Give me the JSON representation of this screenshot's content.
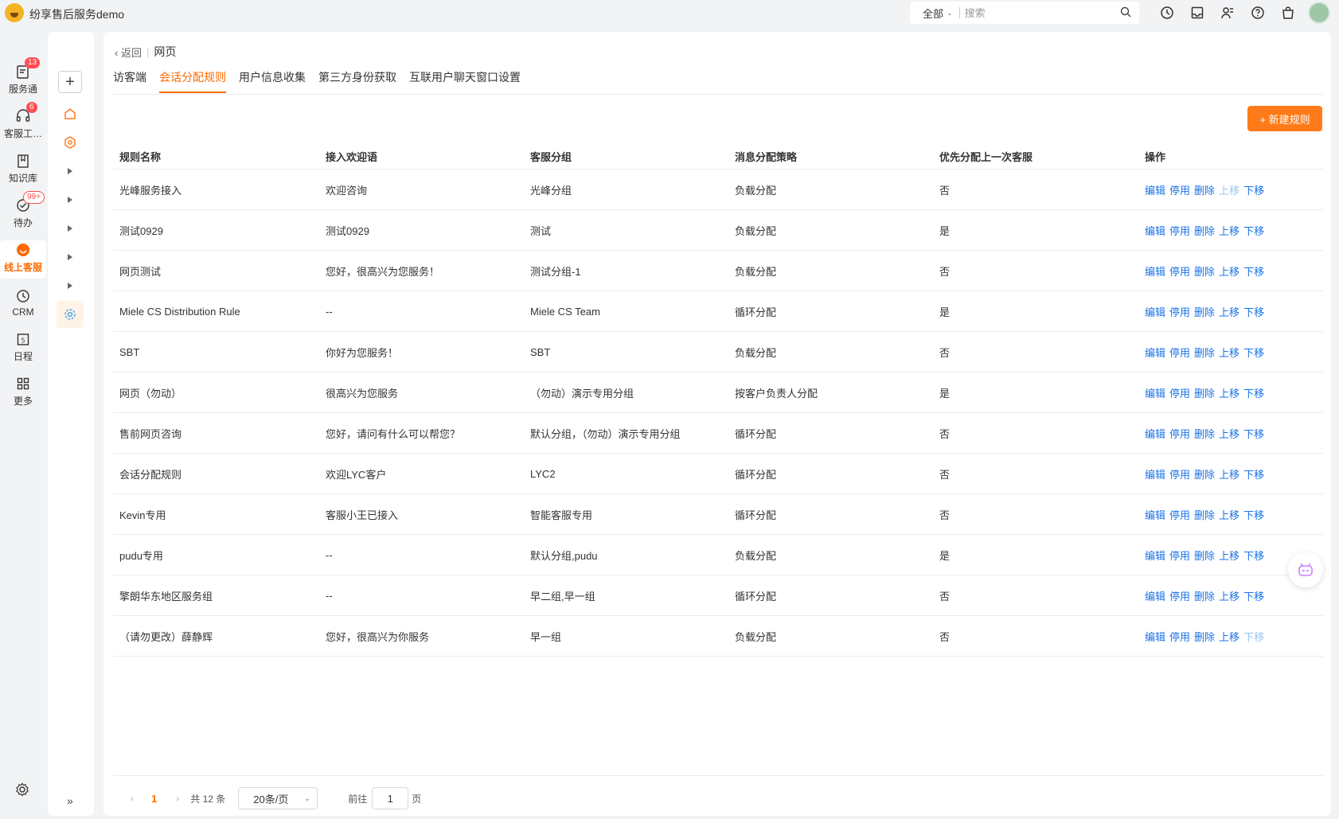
{
  "app": {
    "title": "纷享售后服务demo"
  },
  "search": {
    "scope": "全部",
    "placeholder": "搜索"
  },
  "rail": {
    "items": [
      {
        "label": "服务通",
        "badge": "13"
      },
      {
        "label": "客服工…",
        "badge": "6"
      },
      {
        "label": "知识库",
        "badge": ""
      },
      {
        "label": "待办",
        "badge": "99+"
      },
      {
        "label": "线上客服",
        "badge": ""
      },
      {
        "label": "CRM",
        "badge": ""
      },
      {
        "label": "日程",
        "badge": ""
      },
      {
        "label": "更多",
        "badge": ""
      }
    ]
  },
  "breadcrumb": {
    "back": "返回",
    "current": "网页"
  },
  "tabs": [
    "访客端",
    "会话分配规则",
    "用户信息收集",
    "第三方身份获取",
    "互联用户聊天窗口设置"
  ],
  "new_button": "+ 新建规则",
  "table": {
    "headers": [
      "规则名称",
      "接入欢迎语",
      "客服分组",
      "消息分配策略",
      "优先分配上一次客服",
      "操作"
    ],
    "ops": [
      "编辑",
      "停用",
      "删除",
      "上移",
      "下移"
    ],
    "rows": [
      [
        "光峰服务接入",
        "欢迎咨询",
        "光峰分组",
        "负载分配",
        "否"
      ],
      [
        "测试0929",
        "测试0929",
        "测试",
        "负载分配",
        "是"
      ],
      [
        "网页测试",
        "您好，很高兴为您服务！",
        "测试分组-1",
        "负载分配",
        "否"
      ],
      [
        "Miele CS Distribution Rule",
        "--",
        "Miele CS Team",
        "循环分配",
        "是"
      ],
      [
        "SBT",
        "你好为您服务！",
        "SBT",
        "负载分配",
        "否"
      ],
      [
        "网页（勿动）",
        "很高兴为您服务",
        "（勿动）演示专用分组",
        "按客户负责人分配",
        "是"
      ],
      [
        "售前网页咨询",
        "您好，请问有什么可以帮您？",
        "默认分组，（勿动）演示专用分组",
        "循环分配",
        "否"
      ],
      [
        "会话分配规则",
        "欢迎LYC客户",
        "LYC2",
        "循环分配",
        "否"
      ],
      [
        "Kevin专用",
        "客服小王已接入",
        "智能客服专用",
        "循环分配",
        "否"
      ],
      [
        "pudu专用",
        "--",
        "默认分组,pudu",
        "负载分配",
        "是"
      ],
      [
        "擎朗华东地区服务组",
        "--",
        "早二组,早一组",
        "循环分配",
        "否"
      ],
      [
        "（请勿更改）薛静辉",
        "您好，很高兴为你服务",
        "早一组",
        "负载分配",
        "否"
      ]
    ]
  },
  "pagination": {
    "current": "1",
    "total": "共 12 条",
    "page_size": "20条/页",
    "goto_label": "前往",
    "goto_value": "1",
    "page_unit": "页"
  },
  "colors": {
    "accent": "#ff6a00",
    "link": "#1a73e8"
  }
}
